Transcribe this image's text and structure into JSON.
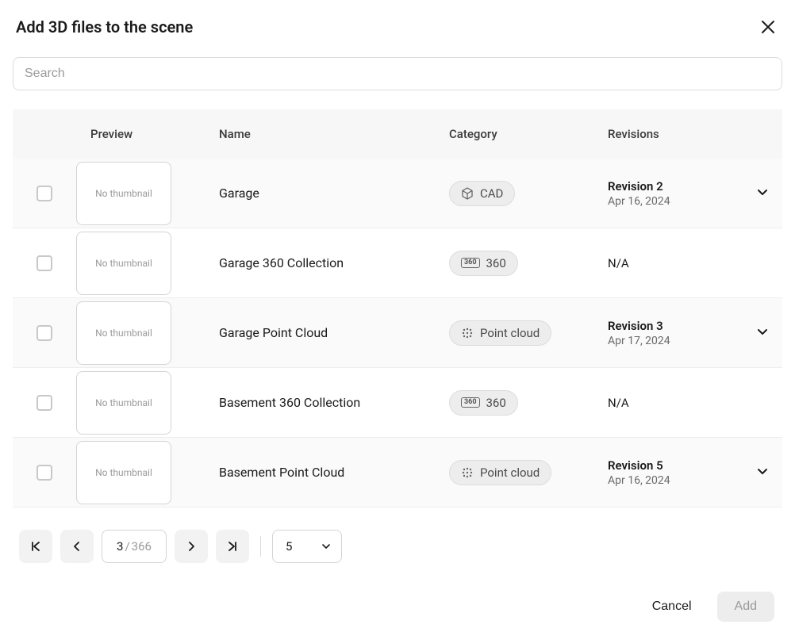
{
  "header": {
    "title": "Add 3D files to the scene"
  },
  "search": {
    "placeholder": "Search",
    "value": ""
  },
  "table": {
    "columns": {
      "preview": "Preview",
      "name": "Name",
      "category": "Category",
      "revisions": "Revisions"
    },
    "no_thumbnail": "No thumbnail",
    "rows": [
      {
        "name": "Garage",
        "category_icon": "cad",
        "category_label": "CAD",
        "revision_title": "Revision 2",
        "revision_date": "Apr 16, 2024",
        "expandable": true
      },
      {
        "name": "Garage 360 Collection",
        "category_icon": "360",
        "category_label": "360",
        "revision_na": "N/A",
        "expandable": false
      },
      {
        "name": "Garage Point Cloud",
        "category_icon": "pointcloud",
        "category_label": "Point cloud",
        "revision_title": "Revision 3",
        "revision_date": "Apr 17, 2024",
        "expandable": true
      },
      {
        "name": "Basement 360 Collection",
        "category_icon": "360",
        "category_label": "360",
        "revision_na": "N/A",
        "expandable": false
      },
      {
        "name": "Basement Point Cloud",
        "category_icon": "pointcloud",
        "category_label": "Point cloud",
        "revision_title": "Revision 5",
        "revision_date": "Apr 16, 2024",
        "expandable": true
      }
    ]
  },
  "pagination": {
    "current": "3",
    "separator": "/",
    "total": "366",
    "page_size": "5"
  },
  "actions": {
    "cancel": "Cancel",
    "add": "Add"
  }
}
